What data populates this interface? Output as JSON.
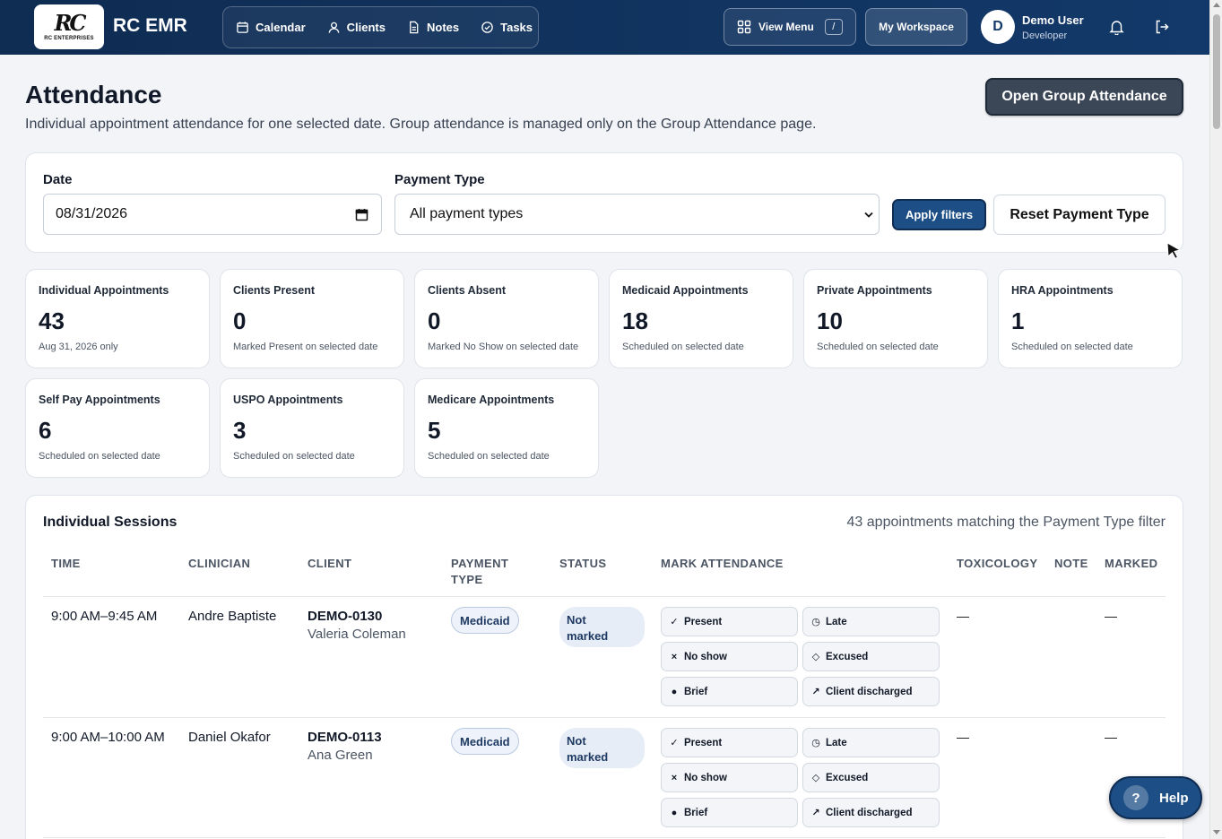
{
  "app": {
    "logo_mark": "RC",
    "logo_sub": "RC ENTERPRISES",
    "brand": "RC EMR"
  },
  "nav": {
    "items": [
      {
        "label": "Calendar",
        "icon": "calendar-icon"
      },
      {
        "label": "Clients",
        "icon": "user-icon"
      },
      {
        "label": "Notes",
        "icon": "document-icon"
      },
      {
        "label": "Tasks",
        "icon": "check-circle-icon"
      }
    ],
    "view_menu_label": "View Menu",
    "view_menu_shortcut": "/",
    "workspace_label": "My Workspace"
  },
  "user": {
    "initial": "D",
    "name": "Demo User",
    "role": "Developer"
  },
  "header": {
    "title": "Attendance",
    "subtitle": "Individual appointment attendance for one selected date. Group attendance is managed only on the Group Attendance page.",
    "open_group_label": "Open Group Attendance"
  },
  "filters": {
    "date_label": "Date",
    "date_value": "08/31/2026",
    "payment_label": "Payment Type",
    "payment_value": "All payment types",
    "apply_label": "Apply filters",
    "reset_label": "Reset Payment Type"
  },
  "stats": [
    {
      "label": "Individual Appointments",
      "value": "43",
      "desc": "Aug 31, 2026 only"
    },
    {
      "label": "Clients Present",
      "value": "0",
      "desc": "Marked Present on selected date"
    },
    {
      "label": "Clients Absent",
      "value": "0",
      "desc": "Marked No Show on selected date"
    },
    {
      "label": "Medicaid Appointments",
      "value": "18",
      "desc": "Scheduled on selected date"
    },
    {
      "label": "Private Appointments",
      "value": "10",
      "desc": "Scheduled on selected date"
    },
    {
      "label": "HRA Appointments",
      "value": "1",
      "desc": "Scheduled on selected date"
    },
    {
      "label": "Self Pay Appointments",
      "value": "6",
      "desc": "Scheduled on selected date"
    },
    {
      "label": "USPO Appointments",
      "value": "3",
      "desc": "Scheduled on selected date"
    },
    {
      "label": "Medicare Appointments",
      "value": "5",
      "desc": "Scheduled on selected date"
    }
  ],
  "sessions": {
    "title": "Individual Sessions",
    "count_text": "43 appointments matching the Payment Type filter",
    "columns": {
      "time": "TIME",
      "clinician": "CLINICIAN",
      "client": "CLIENT",
      "payment_line1": "PAYMENT",
      "payment_line2": "TYPE",
      "status": "STATUS",
      "mark": "MARK ATTENDANCE",
      "tox": "TOXICOLOGY",
      "note": "NOTE",
      "marked": "MARKED"
    },
    "actions": {
      "present": {
        "label": "Present",
        "glyph": "✓"
      },
      "late": {
        "label": "Late",
        "glyph": "◷"
      },
      "noshow": {
        "label": "No show",
        "glyph": "×"
      },
      "excused": {
        "label": "Excused",
        "glyph": "◇"
      },
      "brief": {
        "label": "Brief",
        "glyph": "●"
      },
      "discharged": {
        "label": "Client discharged",
        "glyph": "↗"
      }
    },
    "rows": [
      {
        "time": "9:00 AM–9:45 AM",
        "clinician": "Andre Baptiste",
        "client_id": "DEMO-0130",
        "client_name": "Valeria Coleman",
        "payment": "Medicaid",
        "status_line1": "Not",
        "status_line2": "marked",
        "tox": "—",
        "note": "",
        "marked": "—"
      },
      {
        "time": "9:00 AM–10:00 AM",
        "clinician": "Daniel Okafor",
        "client_id": "DEMO-0113",
        "client_name": "Ana Green",
        "payment": "Medicaid",
        "status_line1": "Not",
        "status_line2": "marked",
        "tox": "—",
        "note": "",
        "marked": "—"
      }
    ]
  },
  "help": {
    "glyph": "?",
    "label": "Help"
  },
  "colors": {
    "topbar": "#12396a",
    "primary": "#1d4f86",
    "badge_bg": "#eef3fb"
  }
}
